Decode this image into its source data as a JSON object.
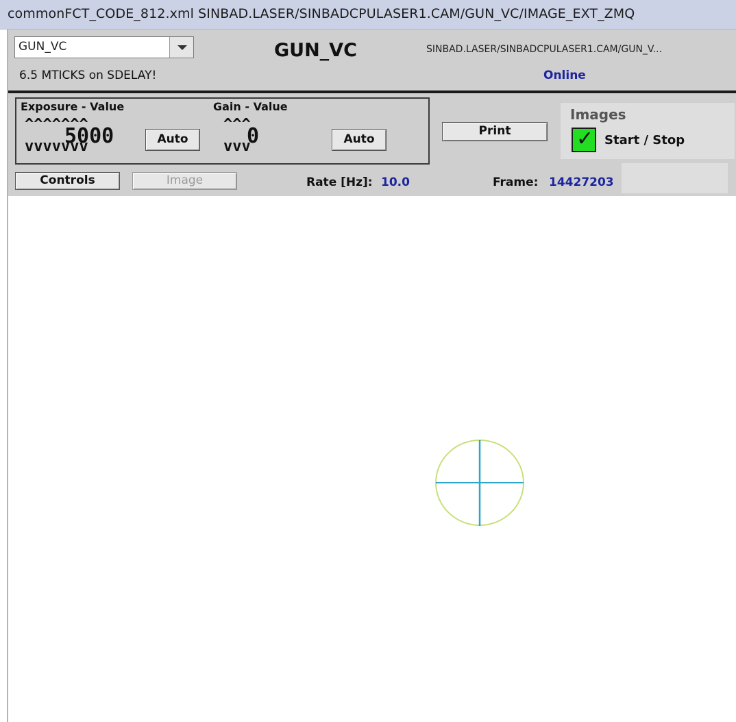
{
  "window": {
    "title": "commonFCT_CODE_812.xml  SINBAD.LASER/SINBADCPULASER1.CAM/GUN_VC/IMAGE_EXT_ZMQ"
  },
  "header": {
    "device_select": "GUN_VC",
    "warning": "6.5 MTICKS on SDELAY!",
    "device_name": "GUN_VC",
    "address": "SINBAD.LASER/SINBADCPULASER1.CAM/GUN_V...",
    "status": "Online"
  },
  "controls": {
    "exposure": {
      "label": "Exposure - Value",
      "up_carets": "^^^^^^^",
      "down_carets": "vvvvvvv",
      "value": "5000",
      "auto_label": "Auto"
    },
    "gain": {
      "label": "Gain - Value",
      "up_carets": "^^^",
      "down_carets": "vvv",
      "value": "0",
      "auto_label": "Auto"
    },
    "print_label": "Print",
    "images": {
      "title": "Images",
      "toggle_label": "Start / Stop",
      "checked_glyph": "✓"
    }
  },
  "bottom_bar": {
    "controls_tab": "Controls",
    "image_tab": "Image",
    "rate_label": "Rate [Hz]:",
    "rate_value": "10.0",
    "frame_label": "Frame:",
    "frame_value": "14427203"
  },
  "colors": {
    "accent_blue": "#1d24a0",
    "check_green": "#22dd22",
    "circle": "#c8e07a",
    "crosshair": "#2aa7c9"
  }
}
